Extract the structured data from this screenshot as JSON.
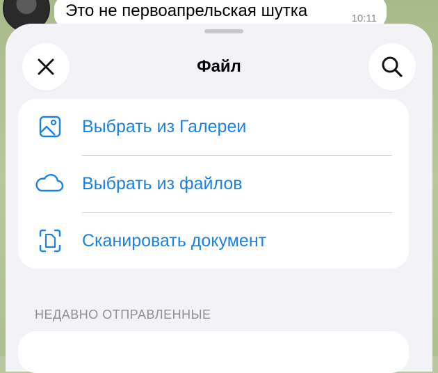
{
  "chat": {
    "message_text": "Это не первоапрельская шутка",
    "message_time": "10:11"
  },
  "sheet": {
    "title": "Файл",
    "close_icon": "close-icon",
    "search_icon": "search-icon",
    "options": [
      {
        "label": "Выбрать из Галереи",
        "icon": "photo-icon"
      },
      {
        "label": "Выбрать из файлов",
        "icon": "cloud-icon"
      },
      {
        "label": "Сканировать документ",
        "icon": "scan-document-icon"
      }
    ],
    "recent_header": "НЕДАВНО ОТПРАВЛЕННЫЕ"
  },
  "colors": {
    "accent": "#1a82e0",
    "sheet_bg": "#f2f2f7",
    "card_bg": "#ffffff",
    "secondary_text": "#8e8e93"
  }
}
